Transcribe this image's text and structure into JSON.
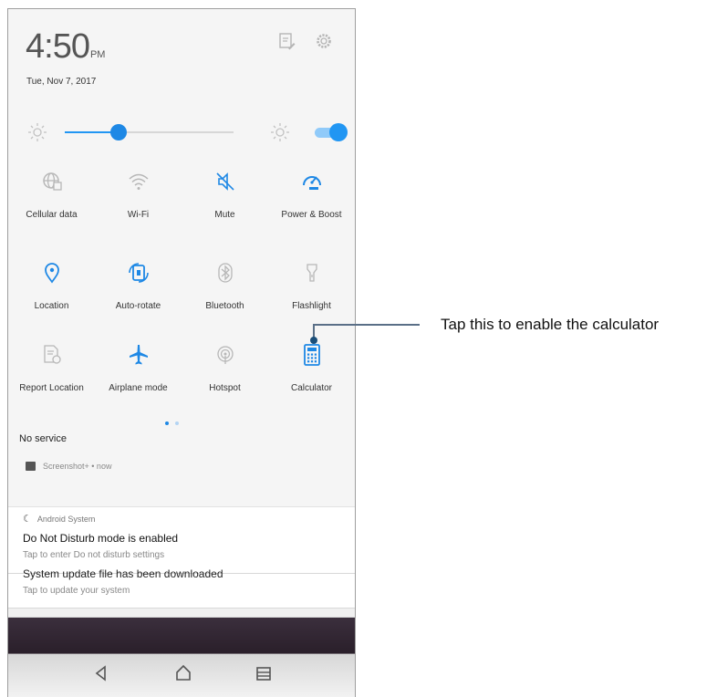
{
  "status": {
    "time": "4:50",
    "ampm": "PM",
    "date": "Tue, Nov 7, 2017"
  },
  "brightness": {
    "level": 0.32,
    "auto_enabled": true
  },
  "colors": {
    "accent": "#1e88e5",
    "icon_inactive": "#b7b7b7",
    "icon_active": "#1e88e5"
  },
  "tiles": [
    {
      "label": "Cellular data",
      "icon": "globe-icon",
      "active": false
    },
    {
      "label": "Wi-Fi",
      "icon": "wifi-icon",
      "active": false
    },
    {
      "label": "Mute",
      "icon": "mute-icon",
      "active": true
    },
    {
      "label": "Power & Boost",
      "icon": "boost-gauge-icon",
      "active": true
    },
    {
      "label": "Location",
      "icon": "location-pin-icon",
      "active": true
    },
    {
      "label": "Auto-rotate",
      "icon": "auto-rotate-icon",
      "active": true
    },
    {
      "label": "Bluetooth",
      "icon": "bluetooth-icon",
      "active": false
    },
    {
      "label": "Flashlight",
      "icon": "flashlight-icon",
      "active": false
    },
    {
      "label": "Report Location",
      "icon": "report-location-icon",
      "active": false
    },
    {
      "label": "Airplane mode",
      "icon": "airplane-icon",
      "active": true
    },
    {
      "label": "Hotspot",
      "icon": "hotspot-icon",
      "active": false
    },
    {
      "label": "Calculator",
      "icon": "calculator-icon",
      "active": true
    }
  ],
  "page_indicator": {
    "pages": 2,
    "current": 0
  },
  "network_status": "No service",
  "screenshot_notification": {
    "text": "Screenshot+ • now"
  },
  "notifications": [
    {
      "app": "Android System",
      "title": "Do Not Disturb mode is enabled",
      "text": "Tap to enter Do not disturb settings"
    },
    {
      "title": "System update file has been downloaded",
      "text": "Tap to update your system"
    }
  ],
  "navbar": {
    "buttons": [
      "back-icon",
      "home-icon",
      "recents-icon"
    ]
  },
  "callout": {
    "text": "Tap this to enable the calculator"
  }
}
